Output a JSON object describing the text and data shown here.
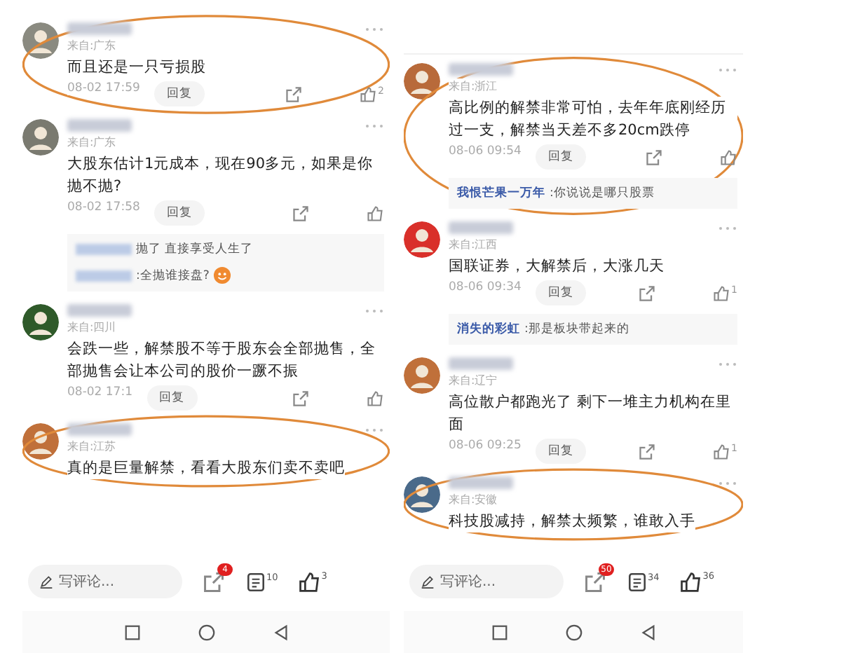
{
  "panels": [
    {
      "comments": [
        {
          "location": "来自:广东",
          "text": "而且还是一只亏损股",
          "time": "08-02 17:59",
          "reply": "回复",
          "likes": "2",
          "circled": true
        },
        {
          "location": "来自:广东",
          "text": "大股东估计1元成本，现在90多元，如果是你抛不抛?",
          "time": "08-02 17:58",
          "reply": "回复",
          "circled": false,
          "replies": [
            {
              "text": "抛了 直接享受人生了",
              "emoji": false
            },
            {
              "text": ":全抛谁接盘?",
              "emoji": true
            }
          ]
        },
        {
          "location": "来自:四川",
          "text": "会跌一些，解禁股不等于股东会全部抛售，全部抛售会让本公司的股价一蹶不振",
          "time": "08-02 17:1",
          "reply": "回复",
          "circled": false
        },
        {
          "location": "来自:江苏",
          "text": "真的是巨量解禁，看看大股东们卖不卖吧",
          "circled": true
        }
      ],
      "bottom_bar": {
        "placeholder": "写评论...",
        "share_badge": "4",
        "comments_count": "10",
        "likes_count": "3"
      }
    },
    {
      "comments": [
        {
          "location": "来自:浙江",
          "text": "高比例的解禁非常可怕，去年年底刚经历过一支，解禁当天差不多20cm跌停",
          "time": "08-06 09:54",
          "reply": "回复",
          "circled": true,
          "replies": [
            {
              "name": "我恨芒果一万年",
              "text": ":你说说是哪只股票",
              "emoji": false
            }
          ]
        },
        {
          "location": "来自:江西",
          "text": "国联证券，大解禁后，大涨几天",
          "time": "08-06 09:34",
          "reply": "回复",
          "likes": "1",
          "circled": false,
          "replies": [
            {
              "name": "消失的彩虹",
              "text": ":那是板块带起来的",
              "emoji": false
            }
          ]
        },
        {
          "location": "来自:辽宁",
          "text": "高位散户都跑光了 剩下一堆主力机构在里面",
          "time": "08-06 09:25",
          "reply": "回复",
          "likes": "1",
          "circled": false
        },
        {
          "location": "来自:安徽",
          "text": "科技股减持，解禁太频繁，谁敢入手",
          "circled": true
        }
      ],
      "bottom_bar": {
        "placeholder": "写评论...",
        "share_badge": "50",
        "comments_count": "34",
        "likes_count": "36"
      }
    }
  ]
}
